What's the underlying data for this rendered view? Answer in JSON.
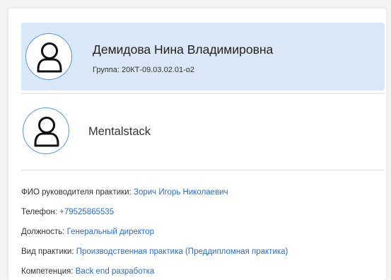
{
  "student": {
    "name": "Демидова Нина Владимировна",
    "group": "Группа: 20КТ-09.03.02.01-о2",
    "avatar_icon": "user-icon"
  },
  "company": {
    "name": "Mentalstack",
    "avatar_icon": "user-icon"
  },
  "info": [
    {
      "label": "ФИО руководителя практики:",
      "value": "Зорич Игорь Николаевич"
    },
    {
      "label": "Телефон:",
      "value": "+79525865535"
    },
    {
      "label": "Должность:",
      "value": "Генеральный директор"
    },
    {
      "label": "Вид практики:",
      "value": "Производственная практика (Преддипломная практика)"
    },
    {
      "label": "Компетенция:",
      "value": "Back end разработка"
    }
  ],
  "colors": {
    "accent": "#2d6cc0",
    "panel_highlight": "#dae7f6",
    "avatar_border": "#5b97d6"
  }
}
